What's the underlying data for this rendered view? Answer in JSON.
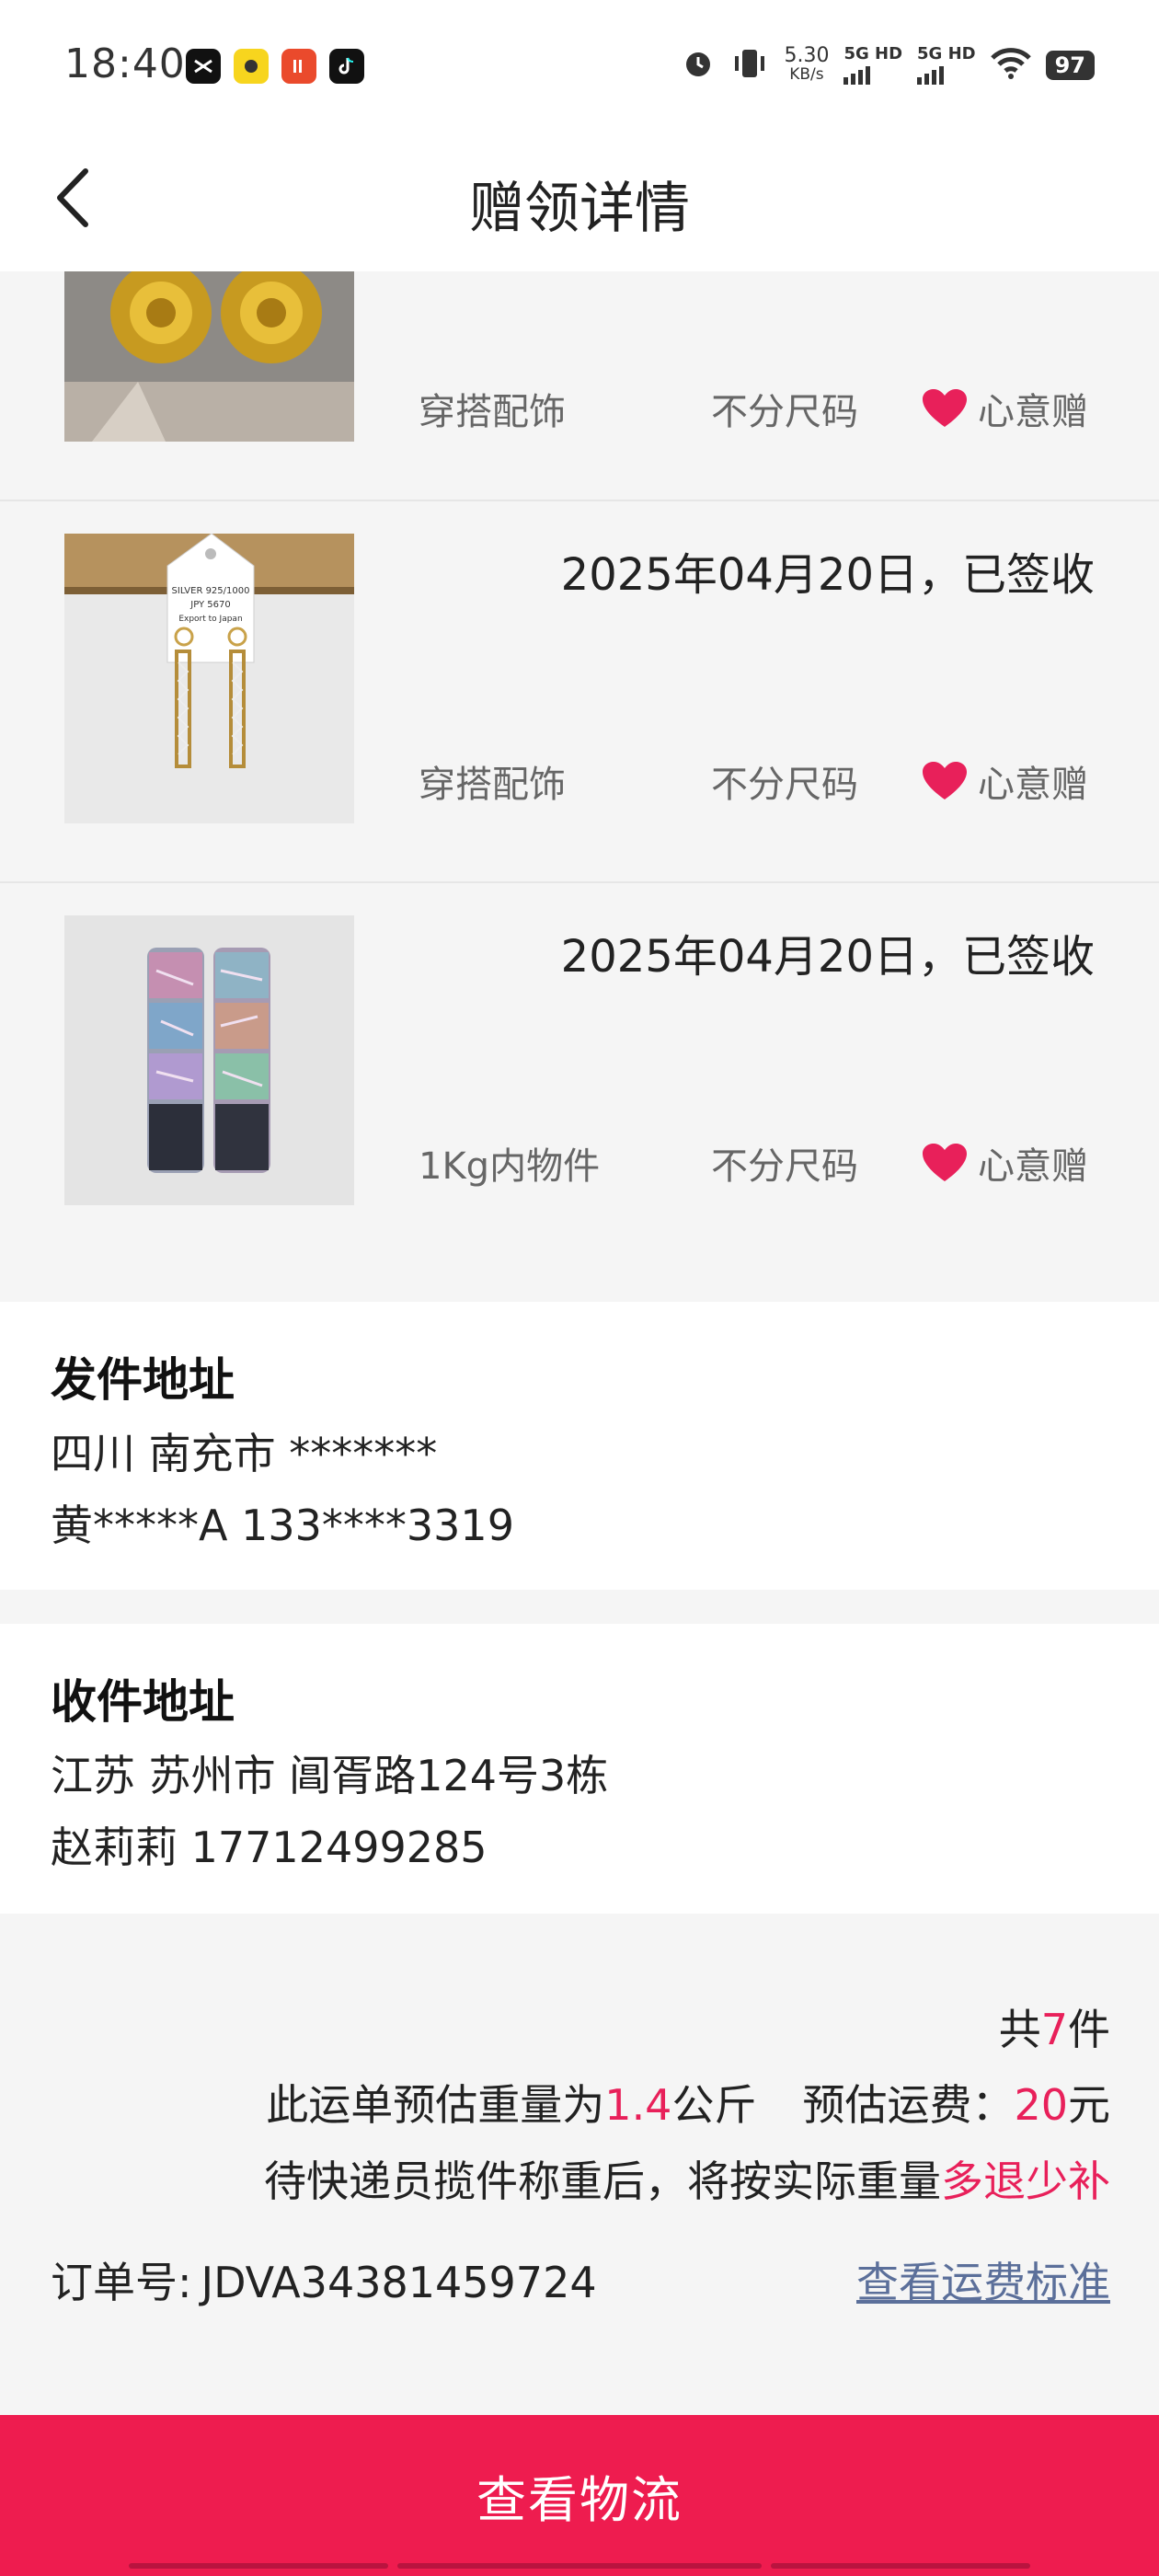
{
  "status_bar": {
    "time": "18:40",
    "net_speed": "5.30",
    "net_unit": "KB/s",
    "net1": "5G HD",
    "net2": "5G HD",
    "battery": "97"
  },
  "header": {
    "title": "赠领详情"
  },
  "items": [
    {
      "status": "",
      "category": "穿搭配饰",
      "size": "不分尺码",
      "gift_label": "心意赠"
    },
    {
      "status": "2025年04月20日，已签收",
      "category": "穿搭配饰",
      "size": "不分尺码",
      "gift_label": "心意赠"
    },
    {
      "status": "2025年04月20日，已签收",
      "category": "1Kg内物件",
      "size": "不分尺码",
      "gift_label": "心意赠"
    }
  ],
  "sender": {
    "title": "发件地址",
    "address": "四川 南充市 *******",
    "contact": "黄*****A 133****3319"
  },
  "receiver": {
    "title": "收件地址",
    "address": "江苏 苏州市 阊胥路124号3栋",
    "contact": "赵莉莉 17712499285"
  },
  "summary": {
    "count_prefix": "共",
    "count": "7",
    "count_suffix": "件",
    "weight_prefix": "此运单预估重量为",
    "weight": "1.4",
    "weight_unit": "公斤",
    "fee_prefix": "预估运费：",
    "fee": "20",
    "fee_unit": "元",
    "note_prefix": "待快递员揽件称重后，将按实际重量",
    "note_highlight": "多退少补",
    "order_label": "订单号:",
    "order_number": "JDVA34381459724",
    "fee_link": "查看运费标准"
  },
  "footer": {
    "button_label": "查看物流"
  },
  "colors": {
    "accent": "#ee1c4f",
    "price_red": "#e8205a",
    "link": "#5b6f9a"
  }
}
